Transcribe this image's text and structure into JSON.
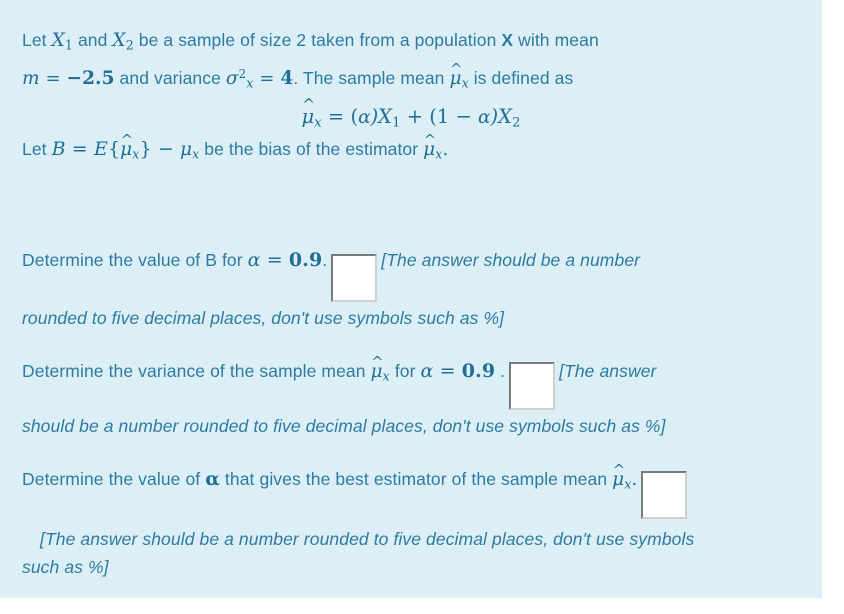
{
  "card": {
    "background_color": "#ddeff6",
    "text_color": "#2d7ba0"
  },
  "intro": {
    "line1_a": "Let ",
    "line1_var1": "X",
    "line1_var1_sub": "1",
    "line1_b": " and ",
    "line1_var2": "X",
    "line1_var2_sub": "2",
    "line1_c": " be a sample of size 2 taken from a population ",
    "line1_popvar": "X",
    "line1_d": " with mean",
    "line2_m": "m",
    "line2_eq": " = ",
    "line2_mval": "−2.5",
    "line2_a": " and variance ",
    "line2_sigma": "σ",
    "line2_sigma_sub": "x",
    "line2_sigma_sup": "2",
    "line2_eq2": " = ",
    "line2_sigmaval": "4",
    "line2_b": ". The sample mean ",
    "line2_muhat": "μ",
    "line2_muhat_sub": "x",
    "line2_c": " is defined as"
  },
  "formula": {
    "lhs_mu": "μ",
    "lhs_sub": "x",
    "eq": "=",
    "rhs": "(α)X₁ + (1 − α)X₂",
    "rhs_open": "(",
    "rhs_alpha": "α",
    "rhs_close_x1": ")X",
    "rhs_x1_sub": "1",
    "rhs_plus": " + (1 − ",
    "rhs_alpha2": "α",
    "rhs_close_x2": ")X",
    "rhs_x2_sub": "2"
  },
  "bias": {
    "a": "Let ",
    "B": "B",
    "eq": " = ",
    "E": "E",
    "brace_open": "{",
    "muhat": "μ",
    "muhat_sub": "x",
    "brace_close": "}",
    "minus": " − ",
    "mu": "μ",
    "mu_sub": "x",
    "b": " be the bias of the estimator ",
    "muhat2": "μ",
    "muhat2_sub": "x",
    "period": "."
  },
  "questions": [
    {
      "id": "q1",
      "prompt_a": "Determine the value of B for ",
      "prompt_alpha": "α",
      "prompt_eq": " = ",
      "prompt_val": "0.9",
      "prompt_b": ".",
      "input_value": "",
      "input_placeholder": "",
      "note_part1": "[The answer should be a number",
      "note_part2": "rounded to five decimal places, don't use symbols such as %]"
    },
    {
      "id": "q2",
      "prompt_a": "Determine the variance of the sample mean ",
      "prompt_muhat": "μ",
      "prompt_muhat_sub": "x",
      "prompt_for": " for ",
      "prompt_alpha": "α",
      "prompt_eq": " = ",
      "prompt_val": "0.9",
      "prompt_b": " .",
      "input_value": "",
      "input_placeholder": "",
      "note_part1": "[The answer",
      "note_part2": "should be a number rounded to five decimal places, don't use symbols such as %]"
    },
    {
      "id": "q3",
      "prompt_a": "Determine the value of ",
      "prompt_alpha": "α",
      "prompt_b": " that gives the best estimator of the sample mean ",
      "prompt_muhat": "μ",
      "prompt_muhat_sub": "x",
      "prompt_c": ".",
      "input_value": "",
      "input_placeholder": "",
      "note_part1": "[The answer should be a number rounded to five decimal places, don't use symbols",
      "note_part2": "such as %]"
    }
  ]
}
